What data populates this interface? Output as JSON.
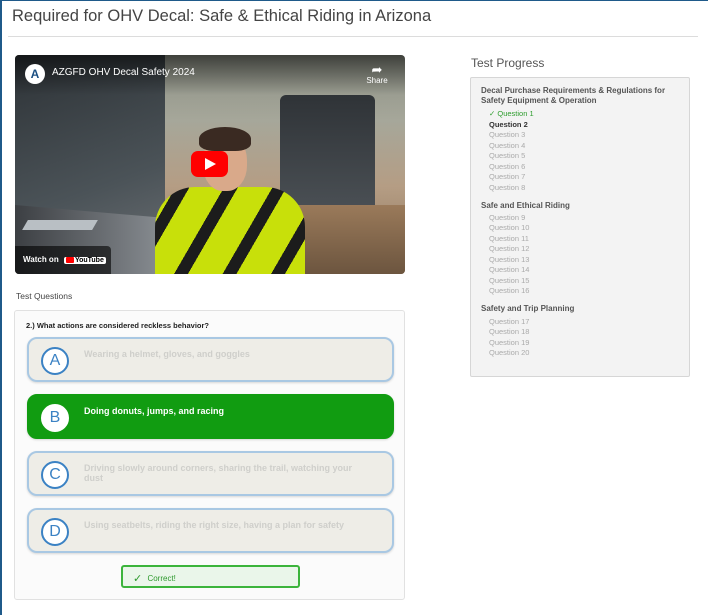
{
  "page": {
    "title": "Required for OHV Decal: Safe & Ethical Riding in Arizona"
  },
  "video": {
    "title": "AZGFD OHV Decal Safety 2024",
    "share_label": "Share",
    "watch_on_label": "Watch on",
    "youtube_label": "YouTube"
  },
  "questions": {
    "section_label": "Test Questions",
    "question_text": "2.) What actions are considered reckless behavior?",
    "answers": [
      {
        "letter": "A",
        "text": "Wearing a helmet, gloves, and goggles",
        "selected": false
      },
      {
        "letter": "B",
        "text": "Doing donuts, jumps, and racing",
        "selected": true
      },
      {
        "letter": "C",
        "text": "Driving slowly around corners, sharing the trail, watching your dust",
        "selected": false
      },
      {
        "letter": "D",
        "text": "Using seatbelts, riding the right size, having a plan for safety",
        "selected": false
      }
    ],
    "feedback": "Correct!"
  },
  "progress": {
    "title": "Test Progress",
    "sections": [
      {
        "title": "Decal Purchase Requirements & Regulations for Safety Equipment & Operation",
        "items": [
          {
            "label": "Question 1",
            "status": "done",
            "prefix": "✓ "
          },
          {
            "label": "Question 2",
            "status": "current"
          },
          {
            "label": "Question 3",
            "status": "pending"
          },
          {
            "label": "Question 4",
            "status": "pending"
          },
          {
            "label": "Question 5",
            "status": "pending"
          },
          {
            "label": "Question 6",
            "status": "pending"
          },
          {
            "label": "Question 7",
            "status": "pending"
          },
          {
            "label": "Question 8",
            "status": "pending"
          }
        ]
      },
      {
        "title": "Safe and Ethical Riding",
        "items": [
          {
            "label": "Question 9",
            "status": "pending"
          },
          {
            "label": "Question 10",
            "status": "pending"
          },
          {
            "label": "Question 11",
            "status": "pending"
          },
          {
            "label": "Question 12",
            "status": "pending"
          },
          {
            "label": "Question 13",
            "status": "pending"
          },
          {
            "label": "Question 14",
            "status": "pending"
          },
          {
            "label": "Question 15",
            "status": "pending"
          },
          {
            "label": "Question 16",
            "status": "pending"
          }
        ]
      },
      {
        "title": "Safety and Trip Planning",
        "items": [
          {
            "label": "Question 17",
            "status": "pending"
          },
          {
            "label": "Question 18",
            "status": "pending"
          },
          {
            "label": "Question 19",
            "status": "pending"
          },
          {
            "label": "Question 20",
            "status": "pending"
          }
        ]
      }
    ]
  },
  "colors": {
    "selected_answer": "#119c11",
    "answer_border": "#a9c8e3",
    "letter_circle": "#3b82c4",
    "done_item": "#2e9d2e"
  }
}
